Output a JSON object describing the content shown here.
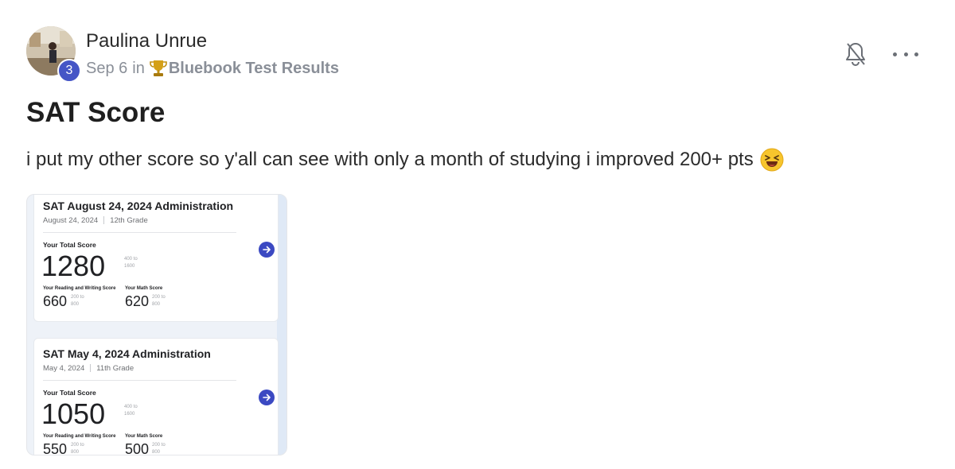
{
  "author": {
    "name": "Paulina Unrue",
    "level": "3"
  },
  "meta": {
    "date": "Sep 6",
    "in": "in",
    "group": "Bluebook Test Results"
  },
  "post": {
    "title": "SAT Score",
    "body": "i put my other score so y'all can see with only a month of studying i improved 200+ pts"
  },
  "icons": {
    "bell": "bell-off-icon",
    "more": "more-horizontal-icon",
    "trophy": "trophy-icon",
    "emoji": "laughing-emoji"
  },
  "colors": {
    "accent": "#4555c6",
    "arrow": "#3b49c2"
  },
  "attachment": {
    "cards": [
      {
        "title": "SAT August 24, 2024 Administration",
        "date": "August 24, 2024",
        "grade": "12th Grade",
        "total_label": "Your Total Score",
        "total": "1280",
        "total_range_1": "400 to",
        "total_range_2": "1600",
        "rw_label": "Your Reading and Writing Score",
        "rw": "660",
        "rw_range_1": "200 to",
        "rw_range_2": "800",
        "math_label": "Your Math Score",
        "math": "620",
        "math_range_1": "200 to",
        "math_range_2": "800"
      },
      {
        "title": "SAT May 4, 2024 Administration",
        "date": "May 4, 2024",
        "grade": "11th Grade",
        "total_label": "Your Total Score",
        "total": "1050",
        "total_range_1": "400 to",
        "total_range_2": "1600",
        "rw_label": "Your Reading and Writing Score",
        "rw": "550",
        "rw_range_1": "200 to",
        "rw_range_2": "800",
        "math_label": "Your Math Score",
        "math": "500",
        "math_range_1": "200 to",
        "math_range_2": "800"
      }
    ]
  }
}
